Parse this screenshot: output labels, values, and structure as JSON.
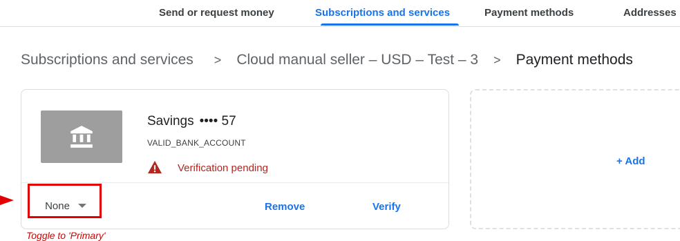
{
  "nav": {
    "tabs": [
      {
        "label": "Send or request money"
      },
      {
        "label": "Subscriptions and services"
      },
      {
        "label": "Payment methods"
      },
      {
        "label": "Addresses"
      }
    ],
    "active_tab": "Subscriptions and services"
  },
  "breadcrumb": {
    "items": [
      "Subscriptions and services",
      "Cloud manual seller – USD – Test – 3",
      "Payment methods"
    ],
    "separator": ">"
  },
  "card": {
    "account_name": "Savings",
    "masked_dots": "••••",
    "account_suffix": "57",
    "account_type": "VALID_BANK_ACCOUNT",
    "status": "Verification pending",
    "status_color": "#b3261e",
    "priority_select": "None",
    "remove_label": "Remove",
    "verify_label": "Verify",
    "bank_icon": "bank-icon",
    "warning_icon": "warning-icon"
  },
  "add": {
    "label": "+ Add"
  },
  "annotation": {
    "text": "Toggle to 'Primary'",
    "color": "#e00000"
  },
  "colors": {
    "accent": "#1a73e8",
    "error": "#b3261e",
    "annotation": "#e00000"
  }
}
